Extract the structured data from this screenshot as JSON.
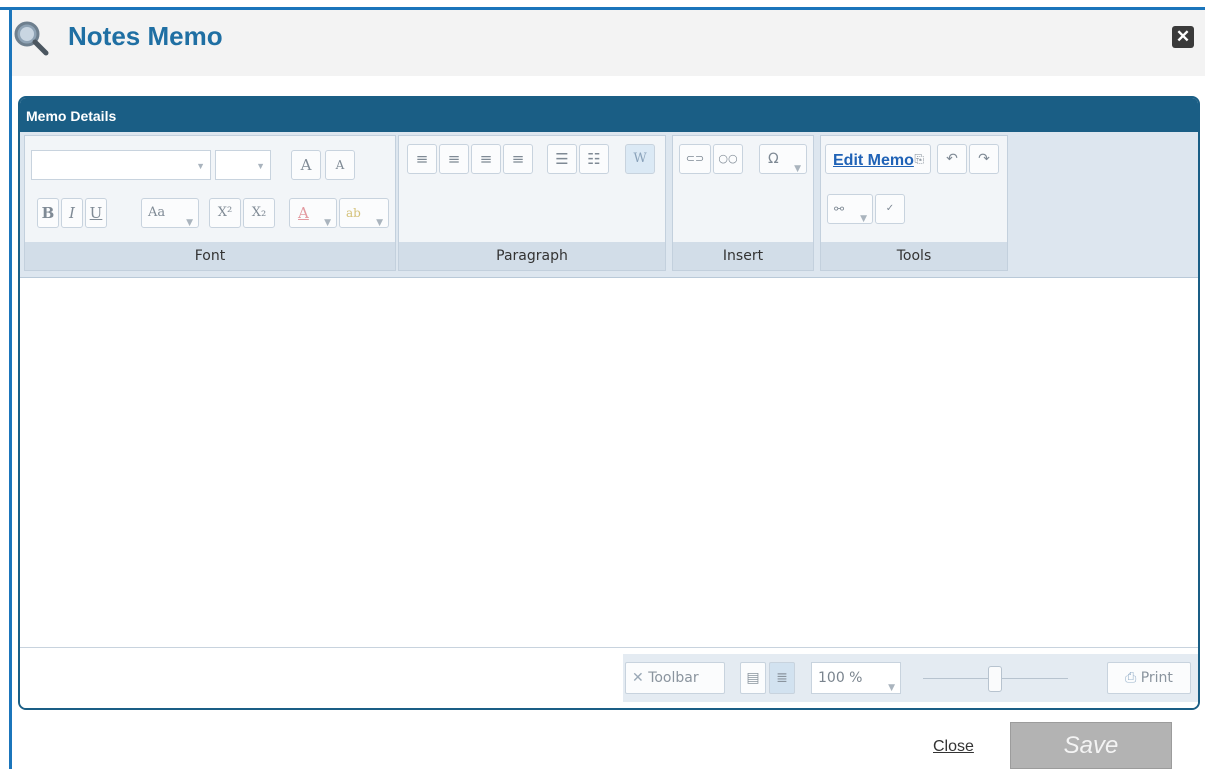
{
  "dialog": {
    "title": "Notes Memo",
    "close_icon_glyph": "✕",
    "brand_color": "#1b75bb"
  },
  "panel": {
    "title": "Memo Details"
  },
  "ribbon": {
    "groups": {
      "font": "Font",
      "paragraph": "Paragraph",
      "insert": "Insert",
      "tools": "Tools"
    },
    "font_buttons": {
      "grow": "A",
      "shrink": "A",
      "bold": "B",
      "italic": "I",
      "underline": "U",
      "change_case": "Aa",
      "superscript": "X²",
      "subscript": "X₂",
      "font_color": "A",
      "highlight": "ab"
    },
    "paragraph_buttons": {
      "word_mode": "W"
    },
    "insert_buttons": {
      "symbol": "Ω"
    },
    "tools": {
      "edit_memo": "Edit Memo"
    }
  },
  "status": {
    "toolbar_label": "Toolbar",
    "zoom_value": "100 %",
    "print_label": "Print"
  },
  "footer": {
    "close_label": "Close",
    "save_label": "Save"
  }
}
